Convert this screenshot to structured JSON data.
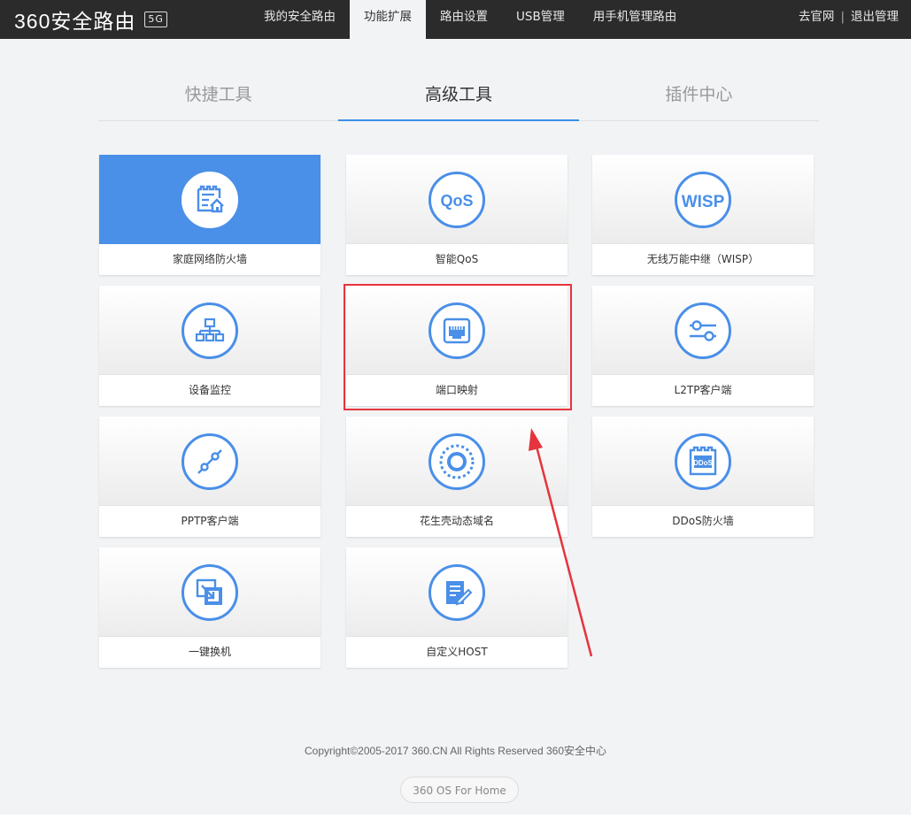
{
  "header": {
    "brand": "360安全路由",
    "badge": "5G",
    "nav": [
      "我的安全路由",
      "功能扩展",
      "路由设置",
      "USB管理",
      "用手机管理路由"
    ],
    "links": [
      "去官网",
      "退出管理"
    ]
  },
  "tabs": [
    "快捷工具",
    "高级工具",
    "插件中心"
  ],
  "cards": [
    {
      "label": "家庭网络防火墙",
      "icon": "firewall-house-icon"
    },
    {
      "label": "智能QoS",
      "icon": "qos-icon",
      "icon_text": "QoS"
    },
    {
      "label": "无线万能中继（WISP）",
      "icon": "wisp-icon",
      "icon_text": "WISP"
    },
    {
      "label": "设备监控",
      "icon": "network-tree-icon"
    },
    {
      "label": "端口映射",
      "icon": "ethernet-port-icon"
    },
    {
      "label": "L2TP客户端",
      "icon": "sliders-icon"
    },
    {
      "label": "PPTP客户端",
      "icon": "link-nodes-icon"
    },
    {
      "label": "花生壳动态域名",
      "icon": "target-ring-icon"
    },
    {
      "label": "DDoS防火墙",
      "icon": "ddos-wall-icon",
      "icon_text": "DDoS"
    },
    {
      "label": "一键换机",
      "icon": "swap-device-icon"
    },
    {
      "label": "自定义HOST",
      "icon": "edit-document-icon"
    }
  ],
  "footer": {
    "copyright": "Copyright©2005-2017 360.CN All Rights Reserved 360安全中心",
    "os_button": "360 OS For Home"
  },
  "colors": {
    "accent": "#4a8fe8",
    "topbar": "#2b2b2b",
    "highlight": "#e5343d"
  }
}
